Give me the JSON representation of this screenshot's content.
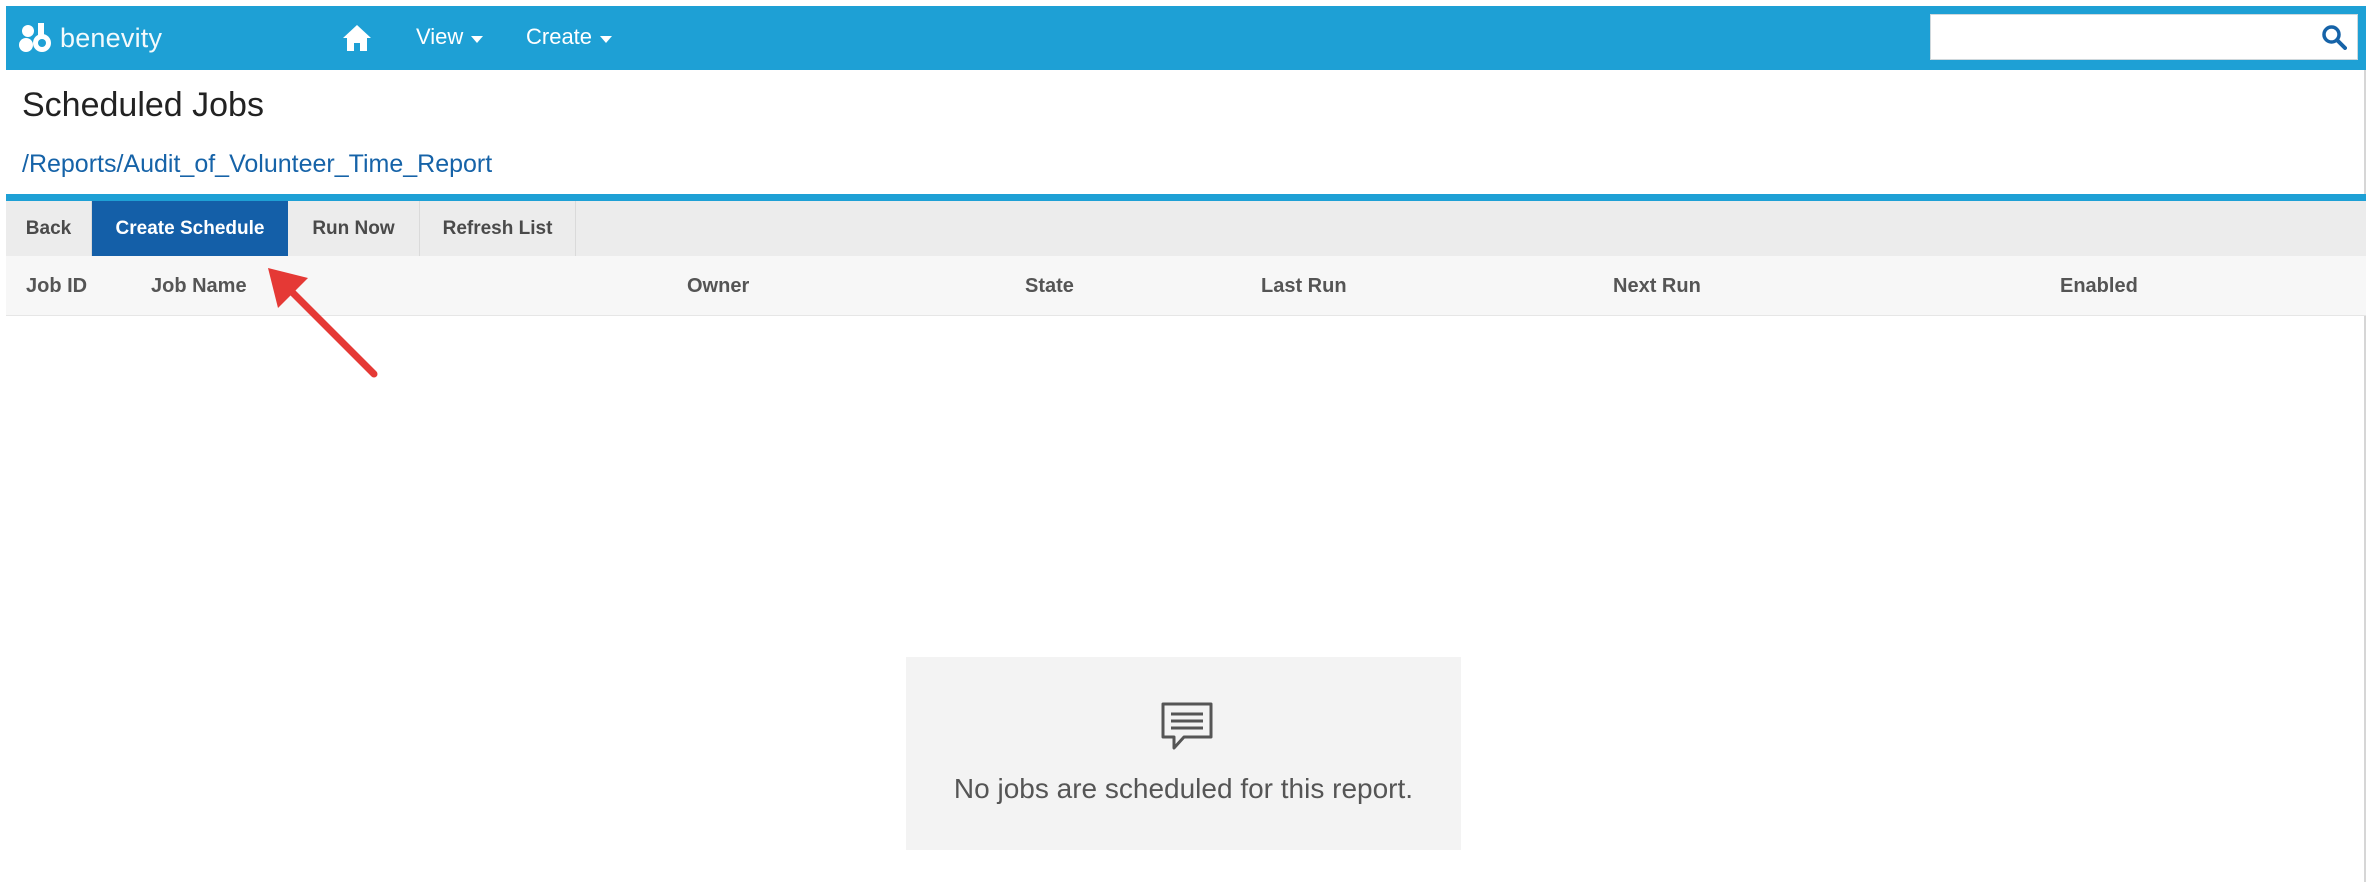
{
  "nav": {
    "brand": "benevity",
    "items": [
      {
        "label": "View"
      },
      {
        "label": "Create"
      }
    ],
    "search": {
      "value": "",
      "placeholder": ""
    },
    "icons": {
      "home": "home-icon",
      "search": "search-icon"
    }
  },
  "header": {
    "title": "Scheduled Jobs",
    "breadcrumb": "/Reports/Audit_of_Volunteer_Time_Report"
  },
  "toolbar": {
    "buttons": [
      {
        "label": "Back",
        "active": false
      },
      {
        "label": "Create Schedule",
        "active": true
      },
      {
        "label": "Run Now",
        "active": false
      },
      {
        "label": "Refresh List",
        "active": false
      }
    ]
  },
  "table": {
    "columns": [
      "Job ID",
      "Job Name",
      "Owner",
      "State",
      "Last Run",
      "Next Run",
      "Enabled"
    ],
    "rows": []
  },
  "empty_state": {
    "icon": "comment-icon",
    "message": "No jobs are scheduled for this report."
  },
  "annotation": {
    "type": "arrow",
    "target": "Create Schedule",
    "color": "#e53935"
  },
  "colors": {
    "nav": "#1ea0d5",
    "active_button": "#145fa8",
    "link": "#1663a8"
  }
}
